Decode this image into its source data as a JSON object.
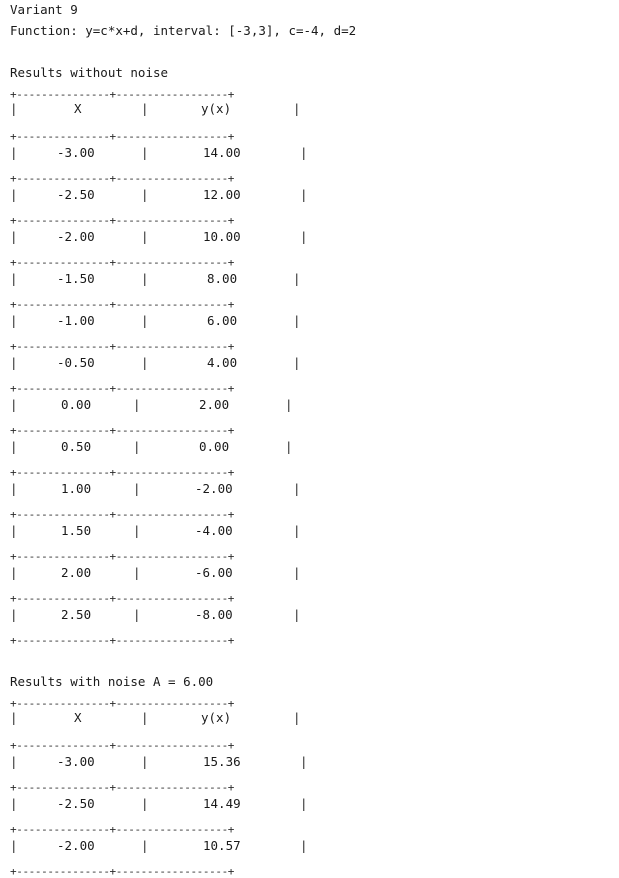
{
  "header": {
    "variant": "Variant 9",
    "function_line": "Function: y=c*x+d, interval: [-3,3], c=-4, d=2"
  },
  "table1": {
    "title": "Results without noise",
    "border": "+---------------+------------------+",
    "head": {
      "x": "X",
      "y": "y(x)"
    },
    "rows": [
      {
        "x": "-3.00",
        "y": "14.00"
      },
      {
        "x": "-2.50",
        "y": "12.00"
      },
      {
        "x": "-2.00",
        "y": "10.00"
      },
      {
        "x": "-1.50",
        "y": "8.00"
      },
      {
        "x": "-1.00",
        "y": "6.00"
      },
      {
        "x": "-0.50",
        "y": "4.00"
      },
      {
        "x": "0.00",
        "y": "2.00"
      },
      {
        "x": "0.50",
        "y": "0.00"
      },
      {
        "x": "1.00",
        "y": "-2.00"
      },
      {
        "x": "1.50",
        "y": "-4.00"
      },
      {
        "x": "2.00",
        "y": "-6.00"
      },
      {
        "x": "2.50",
        "y": "-8.00"
      }
    ]
  },
  "table2": {
    "title": "Results with noise A = 6.00",
    "border": "+---------------+------------------+",
    "head": {
      "x": "X",
      "y": "y(x)"
    },
    "rows": [
      {
        "x": "-3.00",
        "y": "15.36"
      },
      {
        "x": "-2.50",
        "y": "14.49"
      },
      {
        "x": "-2.00",
        "y": "10.57"
      }
    ]
  },
  "separator_char": "|"
}
